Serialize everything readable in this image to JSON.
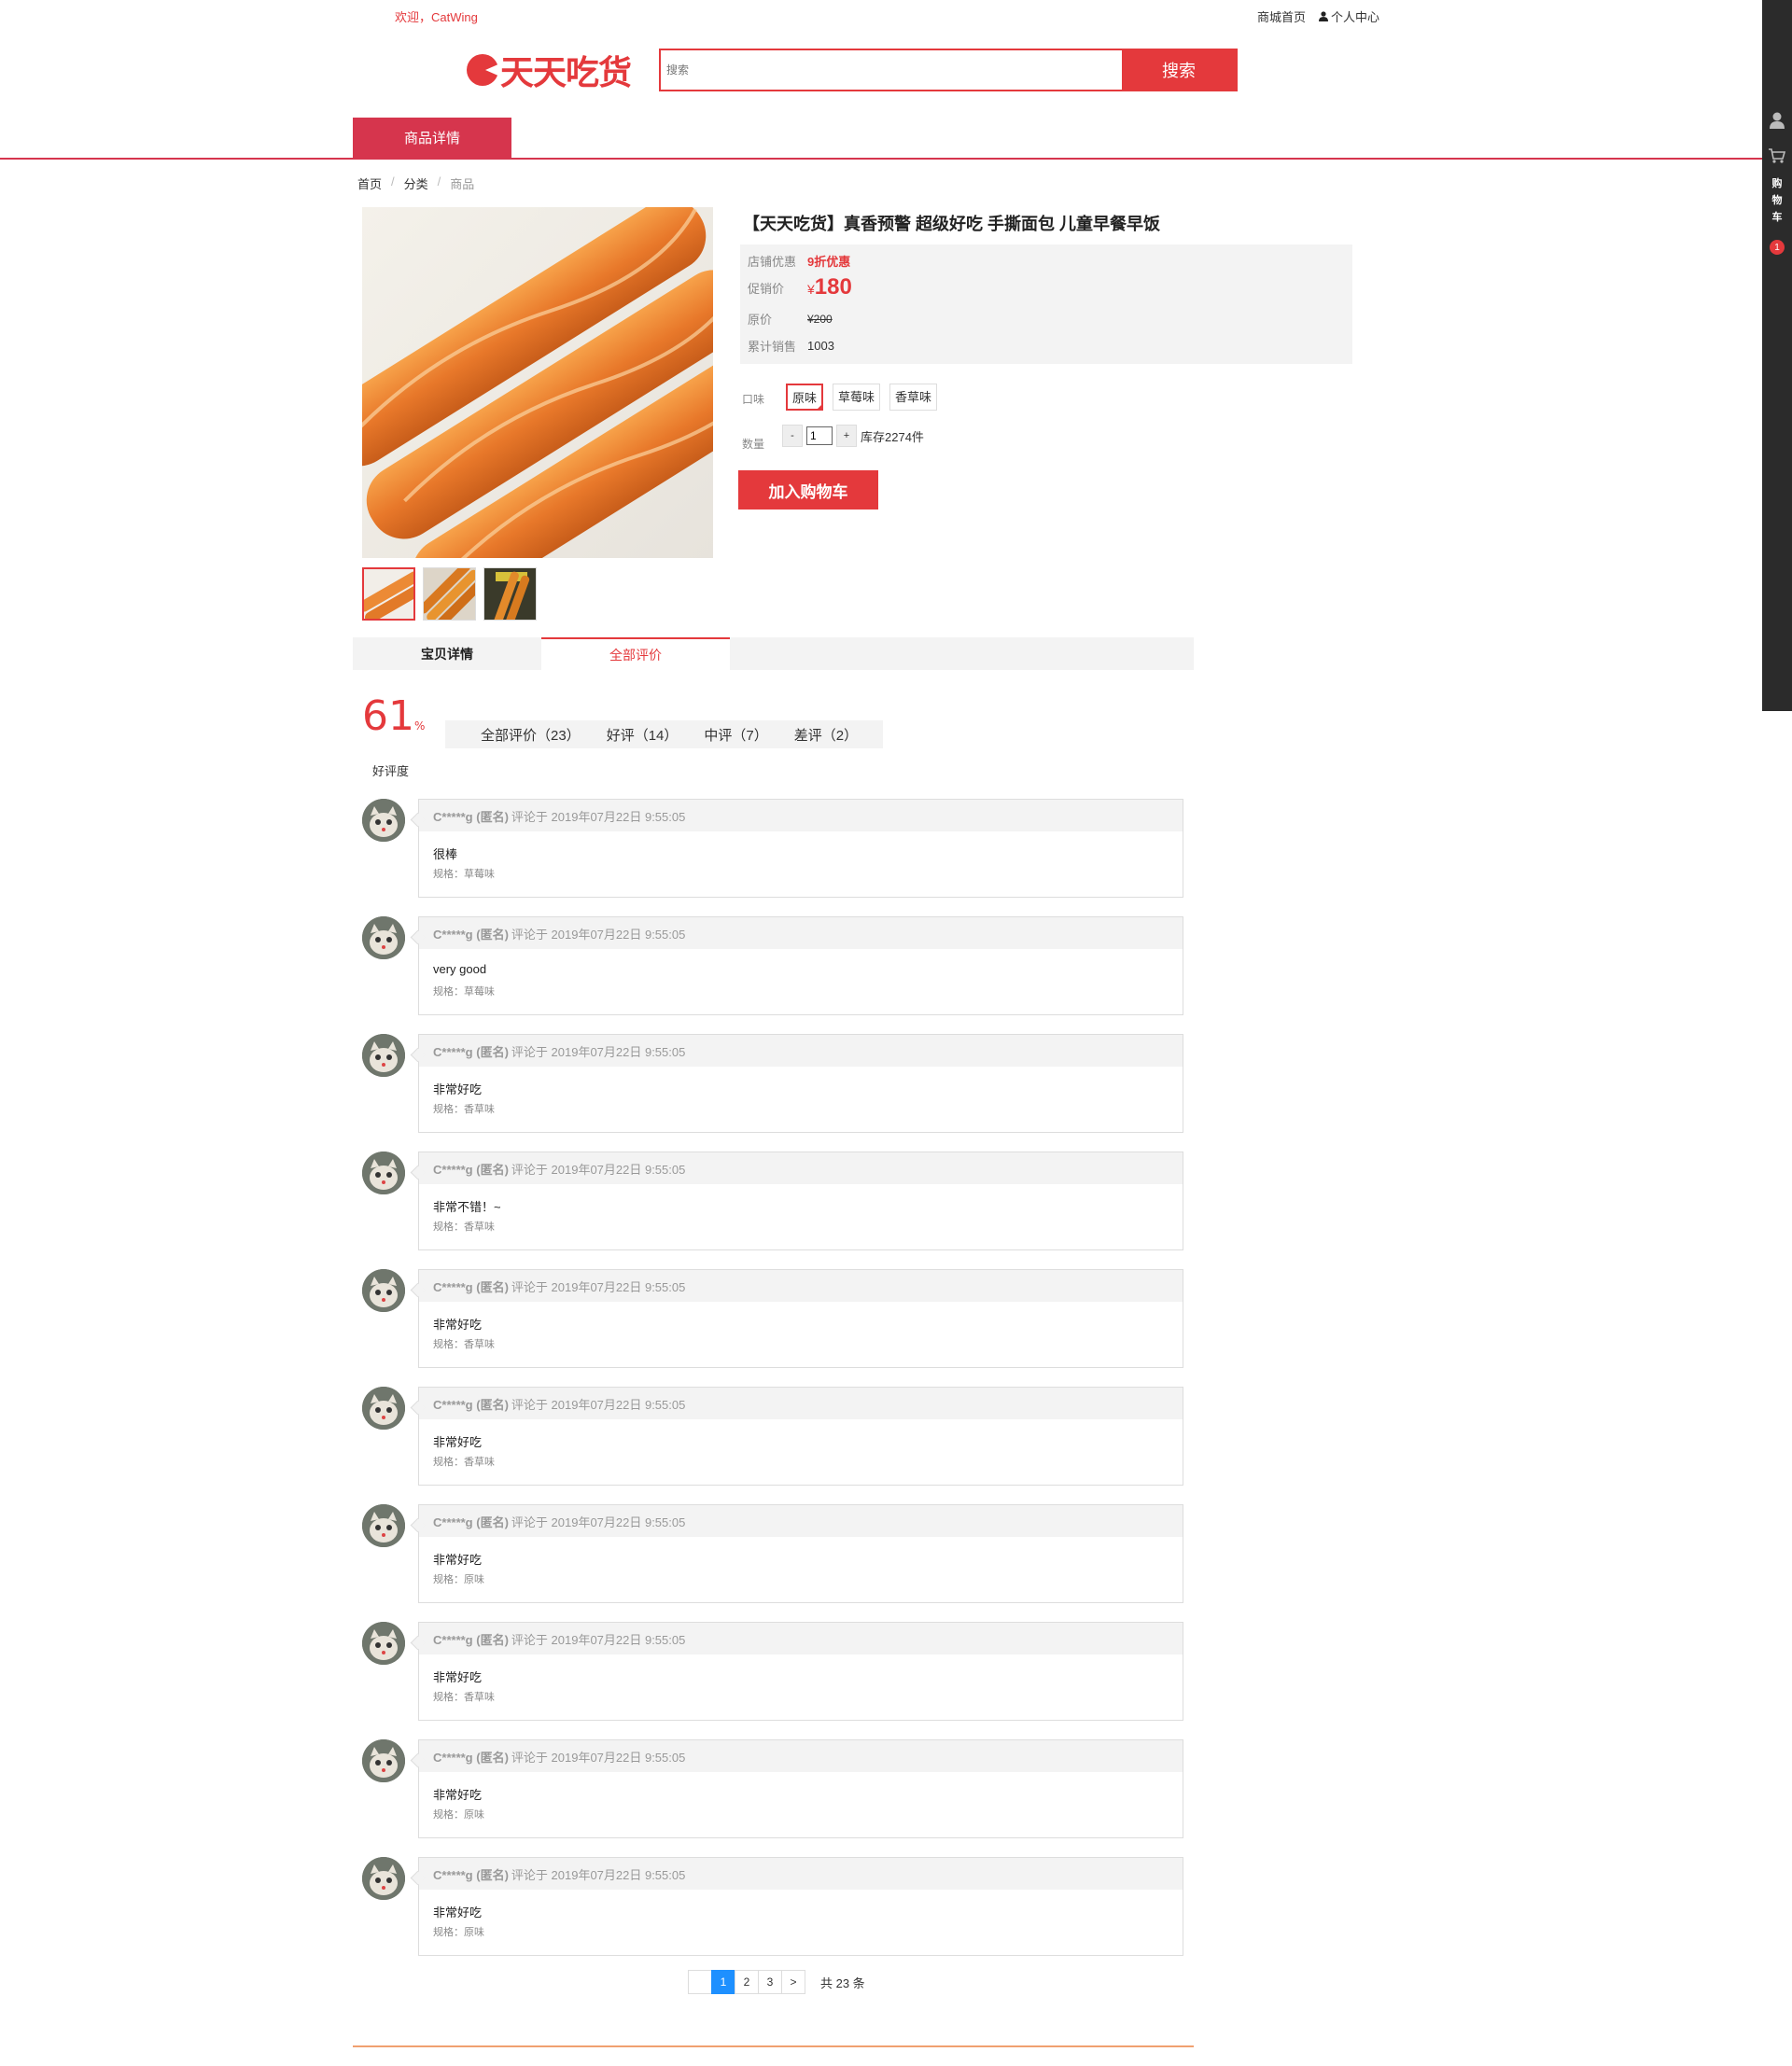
{
  "topbar": {
    "welcome": "欢迎，CatWing",
    "home_link": "商城首页",
    "user_center": "个人中心"
  },
  "logo": {
    "text": "天天吃货"
  },
  "search": {
    "placeholder": "搜索",
    "button": "搜索"
  },
  "nav": {
    "active_tab": "商品详情"
  },
  "breadcrumb": [
    "首页",
    "分类",
    "商品"
  ],
  "product": {
    "title": "【天天吃货】真香预警 超级好吃 手撕面包 儿童早餐早饭",
    "shop_discount_label": "店铺优惠",
    "shop_discount": "9折优惠",
    "promo_label": "促销价",
    "currency": "¥",
    "promo_price": "180",
    "orig_label": "原价",
    "orig_price": "¥200",
    "sales_label": "累计销售",
    "sales": "1003",
    "flavor_label": "口味",
    "flavors": [
      "原味",
      "草莓味",
      "香草味"
    ],
    "qty_label": "数量",
    "qty_minus": "-",
    "qty_plus": "+",
    "qty": "1",
    "stock": "库存2274件",
    "add_cart": "加入购物车"
  },
  "tabs": [
    "宝贝详情",
    "全部评价"
  ],
  "rating": {
    "score": "61",
    "unit": "%",
    "label": "好评度",
    "filters": [
      "全部评价（23）",
      "好评（14）",
      "中评（7）",
      "差评（2）"
    ]
  },
  "comments": [
    {
      "name": "C*****g (匿名)",
      "time": "评论于 2019年07月22日 9:55:05",
      "text": "很棒",
      "spec": "规格：草莓味"
    },
    {
      "name": "C*****g (匿名)",
      "time": "评论于 2019年07月22日 9:55:05",
      "text": "very good",
      "spec": "规格：草莓味"
    },
    {
      "name": "C*****g (匿名)",
      "time": "评论于 2019年07月22日 9:55:05",
      "text": "非常好吃",
      "spec": "规格：香草味"
    },
    {
      "name": "C*****g (匿名)",
      "time": "评论于 2019年07月22日 9:55:05",
      "text": "非常不错！~",
      "spec": "规格：香草味"
    },
    {
      "name": "C*****g (匿名)",
      "time": "评论于 2019年07月22日 9:55:05",
      "text": "非常好吃",
      "spec": "规格：香草味"
    },
    {
      "name": "C*****g (匿名)",
      "time": "评论于 2019年07月22日 9:55:05",
      "text": "非常好吃",
      "spec": "规格：香草味"
    },
    {
      "name": "C*****g (匿名)",
      "time": "评论于 2019年07月22日 9:55:05",
      "text": "非常好吃",
      "spec": "规格：原味"
    },
    {
      "name": "C*****g (匿名)",
      "time": "评论于 2019年07月22日 9:55:05",
      "text": "非常好吃",
      "spec": "规格：香草味"
    },
    {
      "name": "C*****g (匿名)",
      "time": "评论于 2019年07月22日 9:55:05",
      "text": "非常好吃",
      "spec": "规格：原味"
    },
    {
      "name": "C*****g (匿名)",
      "time": "评论于 2019年07月22日 9:55:05",
      "text": "非常好吃",
      "spec": "规格：原味"
    }
  ],
  "pager": {
    "prev": "",
    "pages": [
      "1",
      "2",
      "3"
    ],
    "next": ">",
    "total": "共 23 条"
  },
  "sidebar": {
    "cart_label": "购物车",
    "cart_count": "1"
  },
  "colors": {
    "brand": "#e4393c",
    "nav": "#d6354d",
    "pager_active": "#1e90ff"
  }
}
